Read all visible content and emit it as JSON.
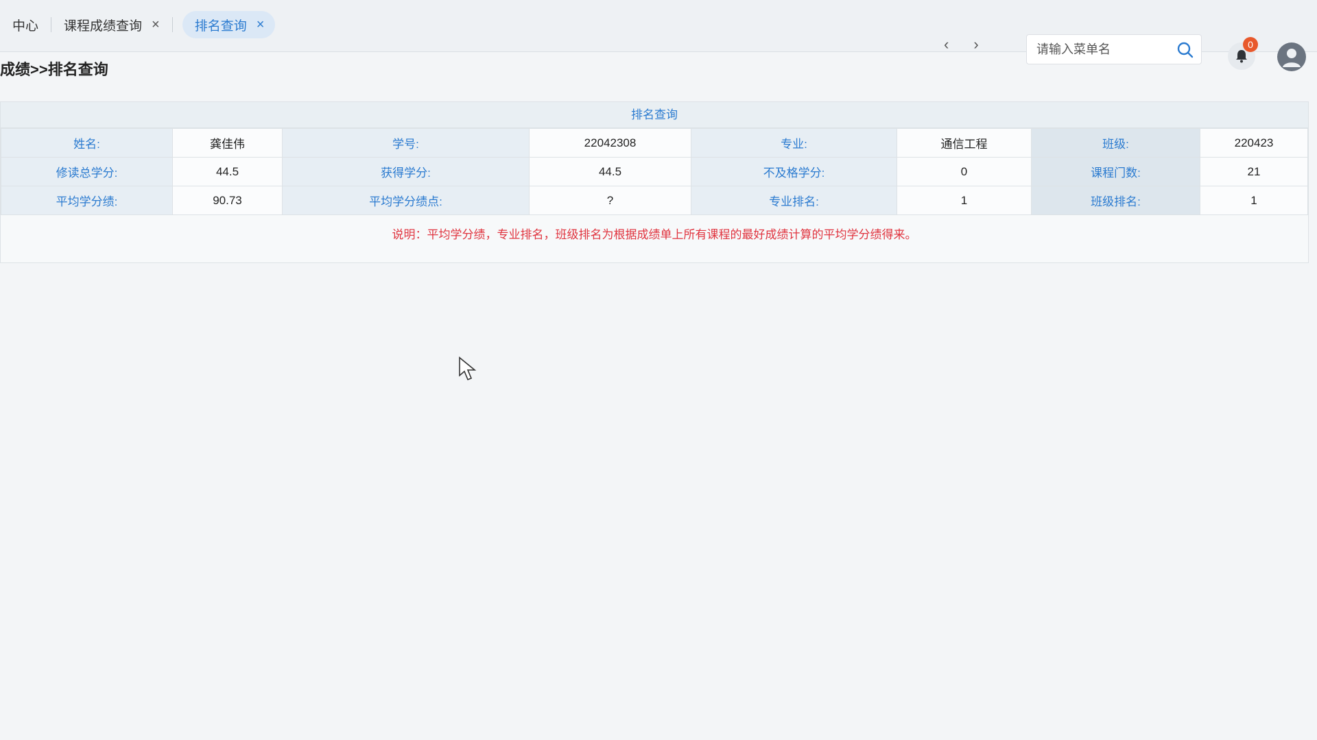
{
  "tabs": {
    "items": [
      {
        "label": "中心",
        "closable": false
      },
      {
        "label": "课程成绩查询",
        "closable": true
      },
      {
        "label": "排名查询",
        "closable": true,
        "active": true
      }
    ],
    "close_glyph": "×"
  },
  "nav": {
    "prev": "‹",
    "next": "›"
  },
  "search": {
    "placeholder": "请输入菜单名",
    "icon": "search-icon"
  },
  "notifications": {
    "count": "0",
    "icon": "bell-icon"
  },
  "user": {
    "icon": "user-avatar-icon"
  },
  "breadcrumb": "成绩>>排名查询",
  "panel": {
    "title": "排名查询",
    "rows": [
      [
        {
          "label": "姓名:",
          "value": "龚佳伟"
        },
        {
          "label": "学号:",
          "value": "22042308"
        },
        {
          "label": "专业:",
          "value": "通信工程"
        },
        {
          "label": "班级:",
          "value": "220423"
        }
      ],
      [
        {
          "label": "修读总学分:",
          "value": "44.5"
        },
        {
          "label": "获得学分:",
          "value": "44.5"
        },
        {
          "label": "不及格学分:",
          "value": "0"
        },
        {
          "label": "课程门数:",
          "value": "21"
        }
      ],
      [
        {
          "label": "平均学分绩:",
          "value": "90.73"
        },
        {
          "label": "平均学分绩点:",
          "value": "?"
        },
        {
          "label": "专业排名:",
          "value": "1"
        },
        {
          "label": "班级排名:",
          "value": "1"
        }
      ]
    ],
    "note": "说明：平均学分绩，专业排名，班级排名为根据成绩单上所有课程的最好成绩计算的平均学分绩得来。"
  },
  "colors": {
    "accent": "#2b7bd0",
    "note": "#e0343f",
    "badge": "#e8592c"
  }
}
